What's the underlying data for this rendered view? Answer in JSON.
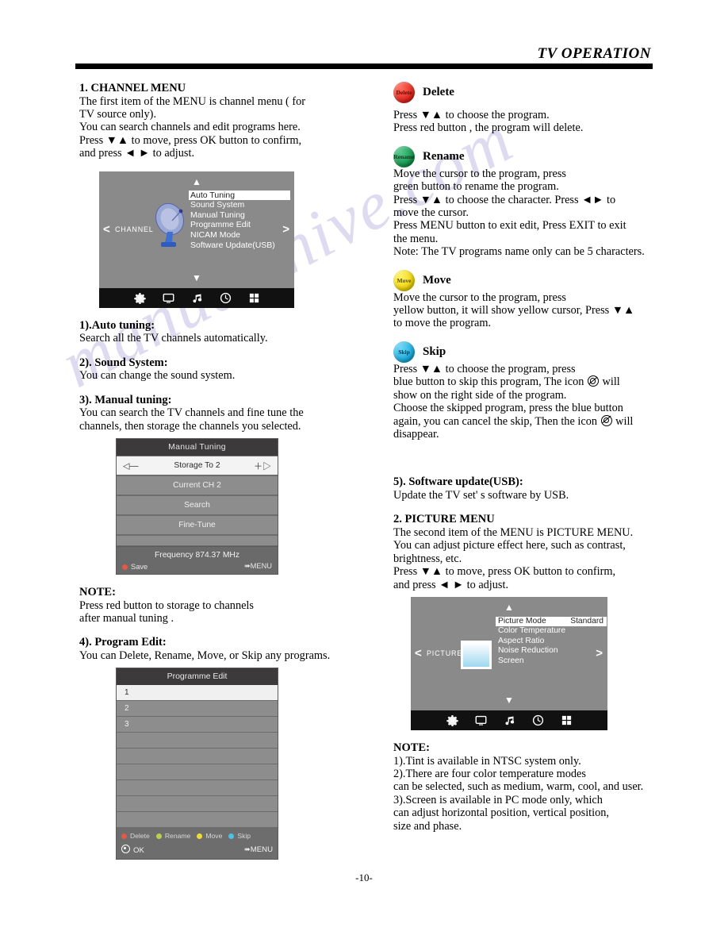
{
  "header": {
    "title": "TV OPERATION"
  },
  "watermark": {
    "text": "manualshive.com"
  },
  "footer": {
    "page_number": "-10-"
  },
  "left_column": {
    "channel_menu": {
      "heading": "1. CHANNEL MENU",
      "lines": [
        "The first item of the MENU is channel menu ( for",
        "TV source only).",
        "You can search channels and edit programs here.",
        "Press  ▼▲ to move, press OK button to confirm,",
        "and press ◄ ► to adjust."
      ]
    },
    "osd_channel": {
      "category_label": "CHANNEL",
      "left_arrow": "<",
      "right_arrow": ">",
      "up_caret": "▲",
      "down_caret": "▼",
      "items": [
        {
          "label": "Auto Tuning",
          "selected": true
        },
        {
          "label": "Sound System",
          "selected": false
        },
        {
          "label": "Manual Tuning",
          "selected": false
        },
        {
          "label": "Programme Edit",
          "selected": false
        },
        {
          "label": "NICAM Mode",
          "selected": false
        },
        {
          "label": "Software Update(USB)",
          "selected": false
        }
      ],
      "iconbar": [
        "gear-icon",
        "monitor-icon",
        "music-note-icon",
        "clock-icon",
        "grid-icon"
      ]
    },
    "auto_tuning": {
      "heading": "1).Auto tuning:",
      "body": "Search all the TV channels automatically."
    },
    "sound_system": {
      "heading": "2). Sound System:",
      "body": "You can change the sound system."
    },
    "manual_tuning": {
      "heading": "3). Manual tuning:",
      "lines": [
        "You can search the TV channels and fine tune the",
        "channels, then storage the channels you selected."
      ]
    },
    "osd_manual": {
      "title": "Manual  Tuning",
      "rows": [
        {
          "label": "Storage To 2",
          "active": true,
          "left_adorn": "◁—",
          "right_adorn": "＋▷"
        },
        {
          "label": "Current CH 2",
          "active": false
        },
        {
          "label": "Search",
          "active": false
        },
        {
          "label": "Fine-Tune",
          "active": false
        },
        {
          "label": "",
          "active": false
        }
      ],
      "frequency": "Frequency  874.37  MHz",
      "save_key": "Save",
      "menu_key": "MENU"
    },
    "note_manual": {
      "heading": "NOTE:",
      "lines": [
        "Press red button to storage to channels",
        "after manual tuning ."
      ]
    },
    "program_edit": {
      "heading": "4). Program Edit:",
      "body": "You can Delete, Rename, Move, or Skip any programs."
    },
    "osd_program": {
      "title": "Programme Edit",
      "rows": [
        {
          "label": "1",
          "selected": true
        },
        {
          "label": "2",
          "selected": false
        },
        {
          "label": "3",
          "selected": false
        },
        {
          "label": "",
          "selected": false
        },
        {
          "label": "",
          "selected": false
        },
        {
          "label": "",
          "selected": false
        },
        {
          "label": "",
          "selected": false
        },
        {
          "label": "",
          "selected": false
        },
        {
          "label": "",
          "selected": false
        }
      ],
      "color_keys": [
        {
          "label": "Delete",
          "color": "red"
        },
        {
          "label": "Rename",
          "color": "green"
        },
        {
          "label": "Move",
          "color": "yellow"
        },
        {
          "label": "Skip",
          "color": "blue"
        }
      ],
      "ok_key": "OK",
      "menu_key": "MENU"
    }
  },
  "right_column": {
    "delete": {
      "button_text": "Delete",
      "caption": "Delete",
      "lines": [
        "Press  ▼▲  to choose the program.",
        "Press red button , the program will delete."
      ]
    },
    "rename": {
      "button_text": "Rename",
      "caption": "Rename",
      "lines": [
        "Move the cursor to the program, press",
        "green button to rename the program.",
        "Press  ▼▲  to choose the character. Press ◄► to",
        "move the cursor.",
        "Press MENU button to exit edit, Press EXIT to exit",
        "the menu.",
        "Note: The TV programs name only can be 5 characters."
      ]
    },
    "move": {
      "button_text": "Move",
      "caption": "Move",
      "lines": [
        "Move the cursor to the program, press",
        "yellow button, it will show yellow cursor, Press ▼▲",
        "to move the program."
      ]
    },
    "skip": {
      "button_text": "Skip",
      "caption": "Skip",
      "line1": "Press ▼▲ to choose the program, press",
      "line2a": "blue button to skip this program, The icon",
      "line2b": "will",
      "line3": "show on the right side of the program.",
      "line4": "Choose the skipped program, press the blue button",
      "line5a": "again, you can cancel the skip, Then the icon",
      "line5b": "will",
      "line6": "disappear."
    },
    "software_update": {
      "heading": "5). Software update(USB):",
      "body": "Update the TV set' s software by USB."
    },
    "picture_menu": {
      "heading": "2. PICTURE MENU",
      "lines": [
        "The second item of the MENU is PICTURE MENU.",
        "You can adjust picture effect here, such as contrast,",
        "brightness, etc.",
        "Press ▼▲ to move, press OK button to confirm,",
        "and press ◄ ► to adjust."
      ]
    },
    "osd_picture": {
      "category_label": "PICTURE",
      "left_arrow": "<",
      "right_arrow": ">",
      "up_caret": "▲",
      "down_caret": "▼",
      "items": [
        {
          "label": "Picture Mode",
          "value": "Standard",
          "selected": true
        },
        {
          "label": "Color Temperature",
          "value": "",
          "selected": false
        },
        {
          "label": "Aspect Ratio",
          "value": "",
          "selected": false
        },
        {
          "label": "Noise Reduction",
          "value": "",
          "selected": false
        },
        {
          "label": "Screen",
          "value": "",
          "selected": false
        }
      ],
      "iconbar": [
        "gear-icon",
        "monitor-icon",
        "music-note-icon",
        "clock-icon",
        "grid-icon"
      ]
    },
    "note_picture": {
      "heading": "NOTE:",
      "lines": [
        "1).Tint is available in NTSC system only.",
        "2).There are four color temperature modes",
        "can be selected, such as medium, warm, cool, and user.",
        "3).Screen is available in PC mode only, which",
        "can adjust horizontal position, vertical position,",
        "size and phase."
      ]
    }
  }
}
